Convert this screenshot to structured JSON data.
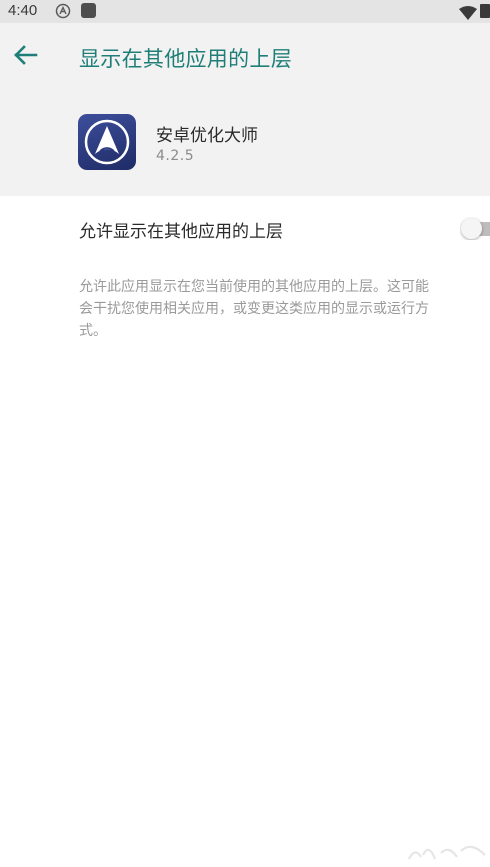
{
  "status_bar": {
    "time": "4:40",
    "icons": [
      "android-auto-icon",
      "app-notification-icon",
      "wifi-icon",
      "battery-icon"
    ]
  },
  "header": {
    "back_icon": "arrow-left-icon",
    "title": "显示在其他应用的上层"
  },
  "app": {
    "name": "安卓优化大师",
    "version": "4.2.5"
  },
  "setting": {
    "label": "允许显示在其他应用的上层",
    "enabled": false,
    "description_lines": [
      "允许此应用显示在您当前使用的其他应用的上层。这可能",
      "会干扰您使用相关应用，或变更这类应用的显示或运行方",
      "式。"
    ]
  },
  "colors": {
    "accent": "#1f7e78",
    "header_bg": "#f2f2f2",
    "status_bg": "#e4e4e4",
    "toggle_track": "#bdbdbd"
  }
}
